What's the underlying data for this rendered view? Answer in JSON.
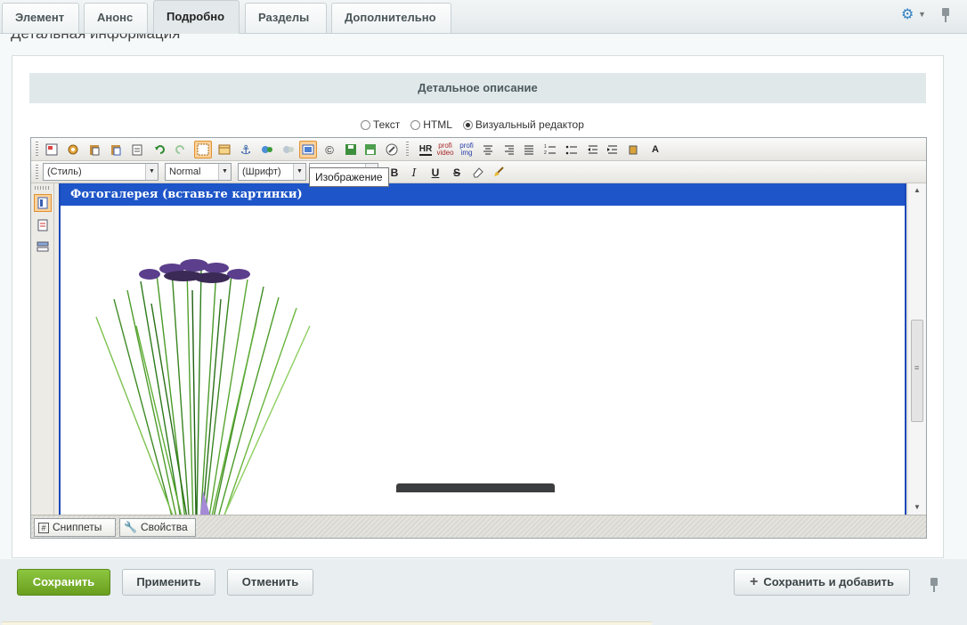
{
  "tabs": [
    {
      "label": "Элемент"
    },
    {
      "label": "Анонс"
    },
    {
      "label": "Подробно",
      "active": true
    },
    {
      "label": "Разделы"
    },
    {
      "label": "Дополнительно"
    }
  ],
  "section": {
    "heading_clipped": "Детальная информация",
    "title": "Детальное описание"
  },
  "modes": {
    "text": "Текст",
    "html": "HTML",
    "visual": "Визуальный редактор",
    "selected": "visual"
  },
  "toolbar": {
    "style_select": "(Стиль)",
    "format_select": "Normal",
    "font_select": "(Шрифт)",
    "tooltip": "Изображение",
    "bold": "B",
    "italic": "I",
    "underline": "U",
    "strike": "S",
    "hr_label": "HR",
    "video_label": "profi video",
    "img_label": "profi img"
  },
  "editor": {
    "gallery_title": "Фотогалерея (вставьте картинки)"
  },
  "bottom_tabs": {
    "snippets": "Сниппеты",
    "properties": "Свойства"
  },
  "footer": {
    "save": "Сохранить",
    "apply": "Применить",
    "cancel": "Отменить",
    "save_add": "Сохранить и добавить"
  },
  "colors": {
    "accent_blue": "#1e55c8",
    "save_green": "#7ab32e",
    "highlight_orange": "#fbd29b"
  }
}
